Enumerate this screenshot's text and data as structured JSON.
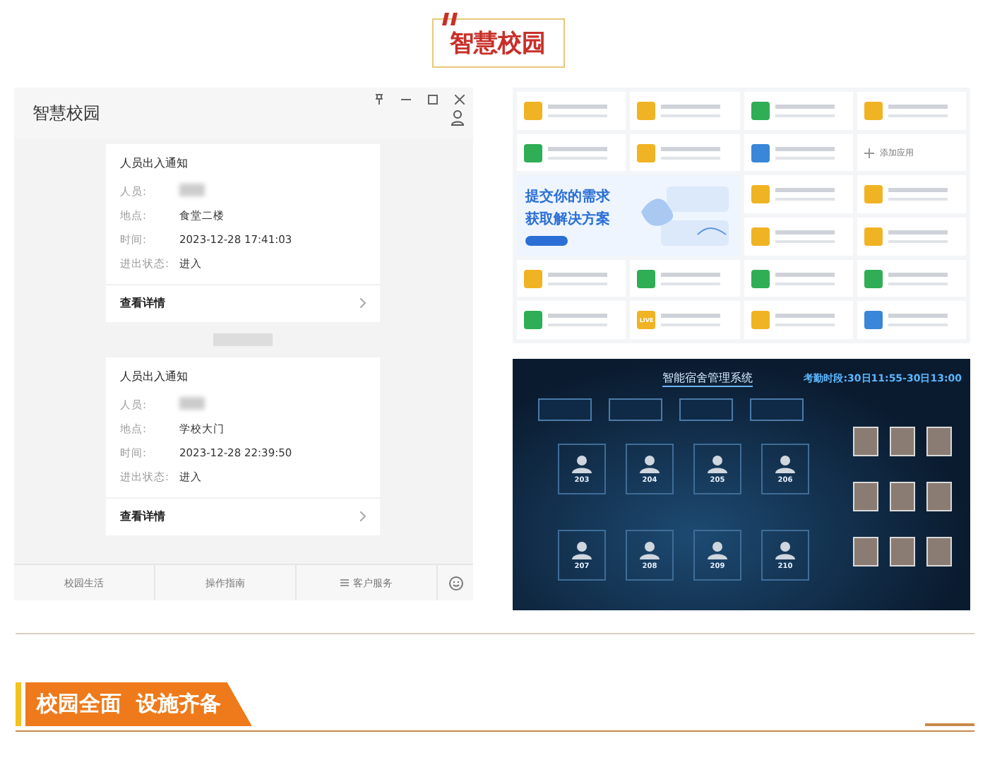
{
  "badge": {
    "title": "智慧校园"
  },
  "window": {
    "title": "智慧校园",
    "notifications": [
      {
        "title": "人员出入通知",
        "fields": [
          {
            "kind": "blurred",
            "label": "人员:"
          },
          {
            "kind": "text",
            "label": "地点:",
            "value": "食堂二楼"
          },
          {
            "kind": "text",
            "label": "时间:",
            "value": "2023-12-28 17:41:03"
          },
          {
            "kind": "text",
            "label": "进出状态:",
            "value": "进入"
          }
        ],
        "link": "查看详情"
      },
      {
        "title": "人员出入通知",
        "fields": [
          {
            "kind": "blurred",
            "label": "人员:"
          },
          {
            "kind": "text",
            "label": "地点:",
            "value": "学校大门"
          },
          {
            "kind": "text",
            "label": "时间:",
            "value": "2023-12-28 22:39:50"
          },
          {
            "kind": "text",
            "label": "进出状态:",
            "value": "进入"
          }
        ],
        "link": "查看详情"
      }
    ],
    "footer_tabs": [
      {
        "label": "校园生活",
        "menu": false
      },
      {
        "label": "操作指南",
        "menu": false
      },
      {
        "label": "客户服务",
        "menu": true
      }
    ]
  },
  "app_grid": {
    "banner": {
      "lines": [
        "提交你的需求",
        "获取解决方案"
      ]
    },
    "apps": [
      {
        "kind": "app",
        "color": "#f0b323"
      },
      {
        "kind": "app",
        "color": "#f0b323"
      },
      {
        "kind": "app",
        "color": "#2fae55"
      },
      {
        "kind": "app",
        "color": "#f0b323"
      },
      {
        "kind": "app",
        "color": "#2fae55"
      },
      {
        "kind": "app",
        "color": "#f0b323"
      },
      {
        "kind": "app",
        "color": "#3a86d8"
      },
      {
        "kind": "add",
        "label": "添加应用"
      },
      {
        "kind": "app",
        "color": "#f0b323"
      },
      {
        "kind": "app",
        "color": "#f0b323"
      },
      {
        "kind": "app",
        "color": "#f0b323"
      },
      {
        "kind": "app",
        "color": "#f0b323"
      },
      {
        "kind": "app",
        "color": "#f0b323"
      },
      {
        "kind": "app",
        "color": "#2fae55"
      },
      {
        "kind": "app",
        "color": "#2fae55"
      },
      {
        "kind": "app",
        "color": "#2fae55"
      },
      {
        "kind": "app",
        "color": "#2fae55"
      },
      {
        "kind": "app",
        "color": "#f0b323",
        "icon_text": "LIVE"
      },
      {
        "kind": "app",
        "color": "#f0b323"
      },
      {
        "kind": "app",
        "color": "#3a86d8"
      }
    ]
  },
  "dashboard": {
    "title": "智能宿舍管理系统",
    "attendance": "考勤时段:30日11:55-30日13:00",
    "rooms": [
      "203",
      "204",
      "205",
      "206",
      "207",
      "208",
      "209",
      "210"
    ]
  },
  "section": {
    "title": "校园全面  设施齐备"
  }
}
